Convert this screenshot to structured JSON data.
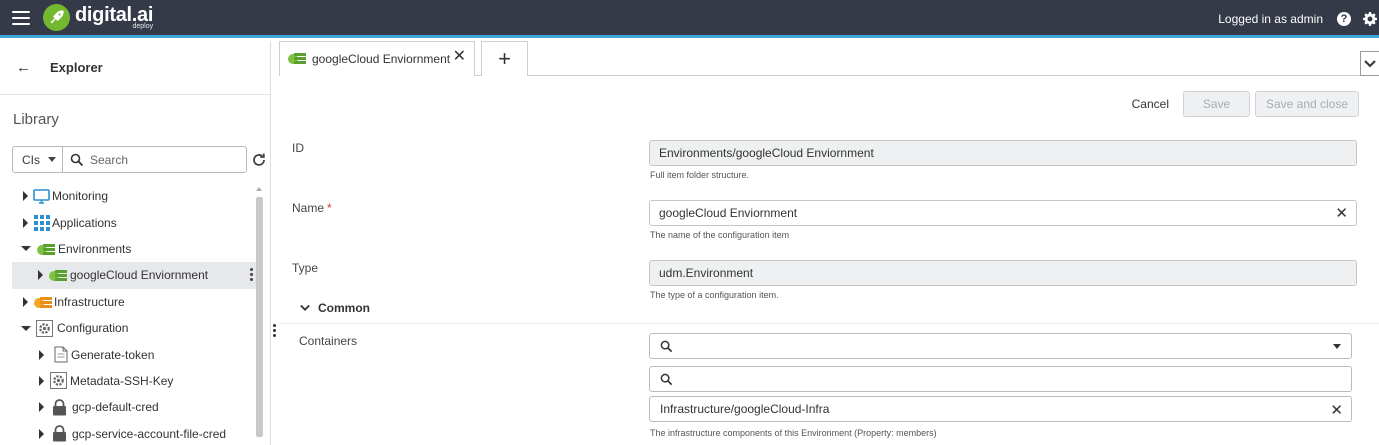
{
  "header": {
    "brand": "digital.ai",
    "brand_sub": "deploy",
    "user_status": "Logged in as admin"
  },
  "explorer": {
    "title": "Explorer",
    "library": "Library",
    "filter_value": "CIs",
    "search_placeholder": "Search",
    "tree": [
      {
        "label": "Monitoring",
        "icon": "monitor-icon",
        "expanded": false
      },
      {
        "label": "Applications",
        "icon": "applications-grid-icon",
        "expanded": false
      },
      {
        "label": "Environments",
        "icon": "environments-icon",
        "expanded": true
      },
      {
        "label": "googleCloud Enviornment",
        "icon": "environments-icon",
        "expanded": false,
        "selected": true
      },
      {
        "label": "Infrastructure",
        "icon": "infrastructure-icon",
        "expanded": false
      },
      {
        "label": "Configuration",
        "icon": "configuration-icon",
        "expanded": true
      },
      {
        "label": "Generate-token",
        "icon": "document-icon",
        "expanded": false
      },
      {
        "label": "Metadata-SSH-Key",
        "icon": "configuration-icon",
        "expanded": false
      },
      {
        "label": "gcp-default-cred",
        "icon": "lock-icon",
        "expanded": false
      },
      {
        "label": "gcp-service-account-file-cred",
        "icon": "lock-icon",
        "expanded": false
      }
    ]
  },
  "tabs": {
    "active_label": "googleCloud Enviornment",
    "add_label": "+"
  },
  "actions": {
    "cancel": "Cancel",
    "save": "Save",
    "save_close": "Save and close"
  },
  "form": {
    "id_label": "ID",
    "id_value": "Environments/googleCloud Enviornment",
    "id_help": "Full item folder structure.",
    "name_label": "Name",
    "name_required": "*",
    "name_value": "googleCloud Enviornment",
    "name_help": "The name of the configuration item",
    "type_label": "Type",
    "type_value": "udm.Environment",
    "type_help": "The type of a configuration item.",
    "section_common": "Common",
    "containers_label": "Containers",
    "container_value": "Infrastructure/googleCloud-Infra",
    "containers_help": "The infrastructure components of this Environment (Property: members)"
  },
  "colors": {
    "topbar": "#353a48",
    "accent": "#3ea6d8",
    "brand_green": "#74b830"
  }
}
